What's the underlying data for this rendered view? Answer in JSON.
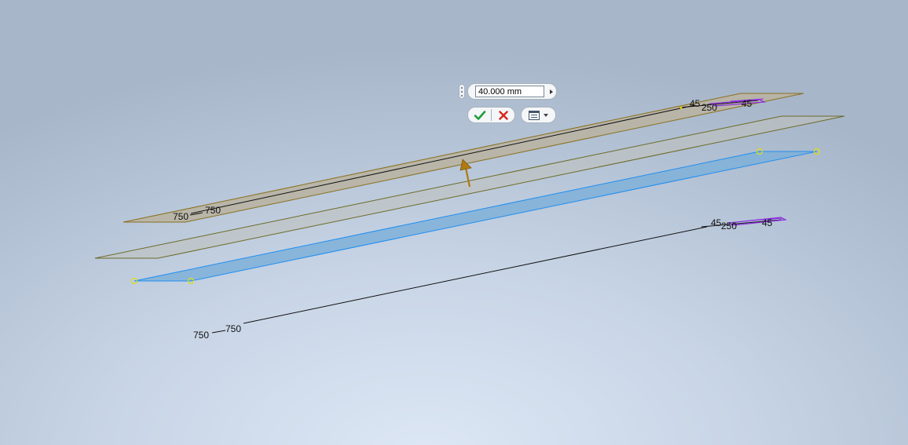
{
  "mini_toolbar": {
    "distance_value": "40.000 mm",
    "apply_icon": "check-icon",
    "cancel_icon": "x-icon",
    "menu_icon": "options-list-icon",
    "colors": {
      "apply": "#1e9e3a",
      "cancel": "#d9261c"
    }
  },
  "dimensions": {
    "top_left_outer": "750",
    "top_left_inner": "750",
    "top_right_angle_1": "45",
    "top_right_width": "250",
    "top_right_angle_2": "45",
    "bottom_left_outer": "750",
    "bottom_left_inner": "750",
    "bottom_right_angle_1": "45",
    "bottom_right_width": "250",
    "bottom_right_angle_2": "45"
  },
  "colors": {
    "preview_face": "#b9b4a3",
    "preview_edge": "#8a7020",
    "selected_face": "#7fb0d8",
    "selected_edge": "#1f8ef0",
    "constraint_color": "#8a2be2",
    "drag_arrow": "#b07a10"
  }
}
